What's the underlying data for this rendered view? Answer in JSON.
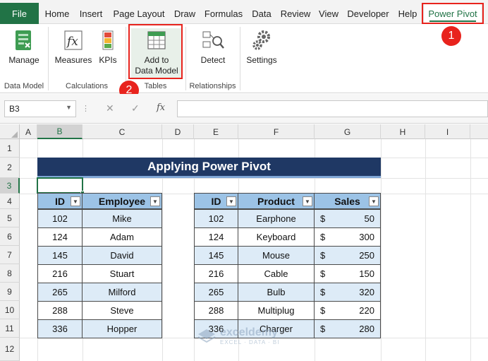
{
  "ribbon_tabs": [
    "File",
    "Home",
    "Insert",
    "Page Layout",
    "Draw",
    "Formulas",
    "Data",
    "Review",
    "View",
    "Developer",
    "Help",
    "Power Pivot"
  ],
  "active_tab": "Power Pivot",
  "ribbon": {
    "manage": "Manage",
    "measures": "Measures",
    "kpis": "KPIs",
    "add_data_model_line1": "Add to",
    "add_data_model_line2": "Data Model",
    "detect": "Detect",
    "settings": "Settings",
    "groups": [
      "Data Model",
      "Calculations",
      "Tables",
      "Relationships"
    ]
  },
  "steps": [
    "1",
    "2"
  ],
  "formula_bar": {
    "name_box": "B3",
    "fx_label": "fx",
    "formula": ""
  },
  "columns": [
    "A",
    "B",
    "C",
    "D",
    "E",
    "F",
    "G",
    "H",
    "I"
  ],
  "rows": [
    "1",
    "2",
    "3",
    "4",
    "5",
    "6",
    "7",
    "8",
    "9",
    "10",
    "11",
    "12"
  ],
  "selected_cell": "B3",
  "sheet_title": "Applying Power Pivot",
  "table1": {
    "headers": [
      "ID",
      "Employee"
    ],
    "rows": [
      [
        "102",
        "Mike"
      ],
      [
        "124",
        "Adam"
      ],
      [
        "145",
        "David"
      ],
      [
        "216",
        "Stuart"
      ],
      [
        "265",
        "Milford"
      ],
      [
        "288",
        "Steve"
      ],
      [
        "336",
        "Hopper"
      ]
    ]
  },
  "table2": {
    "headers": [
      "ID",
      "Product",
      "Sales"
    ],
    "currency": "$",
    "rows": [
      [
        "102",
        "Earphone",
        "50"
      ],
      [
        "124",
        "Keyboard",
        "300"
      ],
      [
        "145",
        "Mouse",
        "250"
      ],
      [
        "216",
        "Cable",
        "150"
      ],
      [
        "265",
        "Bulb",
        "320"
      ],
      [
        "288",
        "Multiplug",
        "220"
      ],
      [
        "336",
        "Charger",
        "280"
      ]
    ]
  },
  "watermark": {
    "title": "exceldemy",
    "subtitle": "EXCEL · DATA · BI"
  },
  "colors": {
    "excel_green": "#217346",
    "highlight_red": "#e8231d",
    "title_navy": "#1f3864",
    "header_blue": "#9cc3e6",
    "band_blue": "#ddebf7"
  }
}
